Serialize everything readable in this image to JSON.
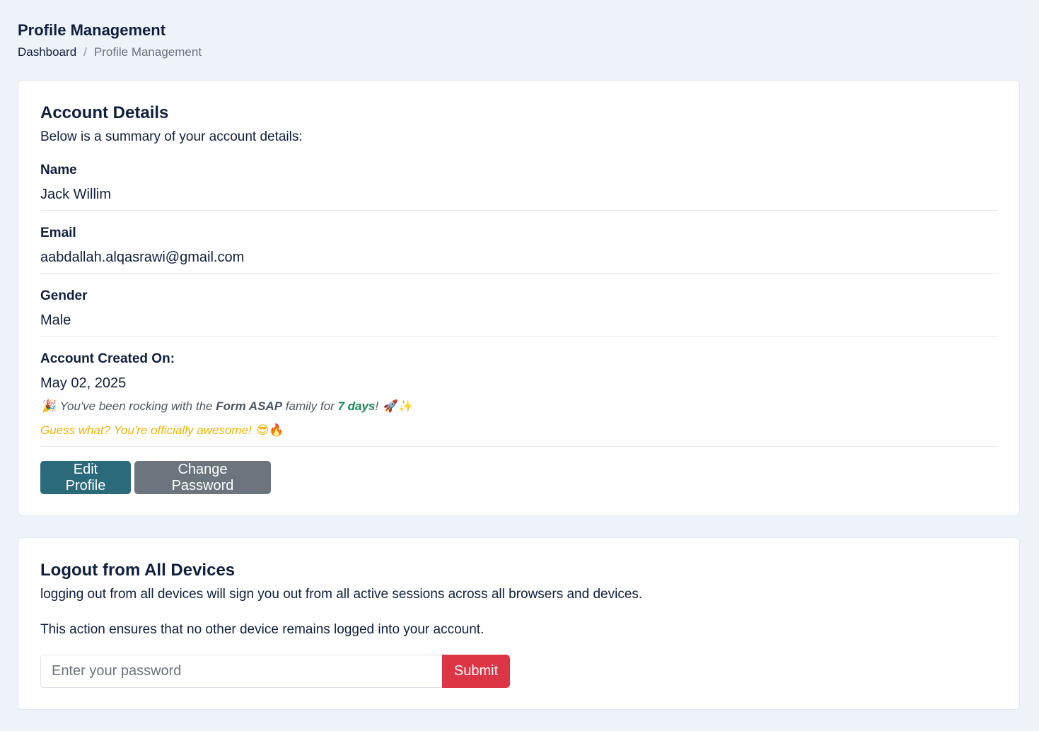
{
  "header": {
    "title": "Profile Management",
    "breadcrumb": {
      "home": "Dashboard",
      "separator": "/",
      "current": "Profile Management"
    }
  },
  "account": {
    "title": "Account Details",
    "subtitle": "Below is a summary of your account details:",
    "fields": [
      {
        "label": "Name",
        "value": "Jack Willim"
      },
      {
        "label": "Email",
        "value": "aabdallah.alqasrawi@gmail.com"
      },
      {
        "label": "Gender",
        "value": "Male"
      },
      {
        "label": "Account Created On:",
        "value": "May 02, 2025"
      }
    ],
    "tenure": {
      "emoji_start": "🎉",
      "prefix": "You've been rocking with the ",
      "brand": "Form ASAP",
      "middle": " family for ",
      "days": "7 days",
      "suffix": "!",
      "emoji_end": "🚀✨"
    },
    "awesome": {
      "text": "Guess what? You're officially awesome!",
      "emoji": "😎🔥"
    },
    "buttons": {
      "edit": "Edit Profile",
      "change_password": "Change Password"
    }
  },
  "logout": {
    "title": "Logout from All Devices",
    "description": "logging out from all devices will sign you out from all active sessions across all browsers and devices.",
    "note": "This action ensures that no other device remains logged into your account.",
    "password_placeholder": "Enter your password",
    "password_value": "",
    "submit": "Submit"
  },
  "colors": {
    "page_bg": "#eef2f9",
    "card_bg": "#ffffff",
    "text": "#0f1f3d",
    "edit_button": "#2b6a7a",
    "password_button": "#6c757d",
    "submit_button": "#dc3545",
    "days_highlight": "#198754",
    "awesome_text": "#f0b400"
  }
}
